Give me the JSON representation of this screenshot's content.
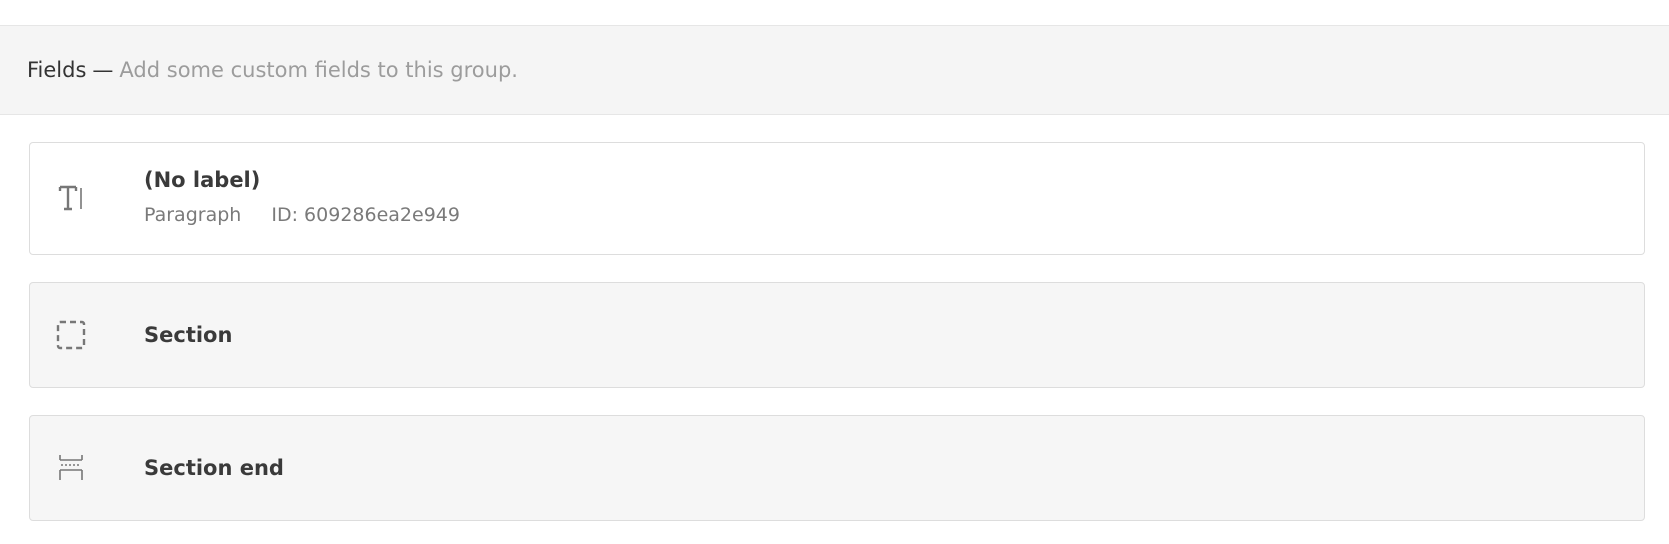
{
  "header": {
    "title": "Fields",
    "separator": "—",
    "description": "Add some custom fields to this group."
  },
  "fields": [
    {
      "label": "(No label)",
      "type": "Paragraph",
      "id_text": "ID: 609286ea2e949",
      "icon": "text-cursor-icon"
    },
    {
      "label": "Section",
      "icon": "dashed-square-icon"
    },
    {
      "label": "Section end",
      "icon": "section-end-icon"
    }
  ],
  "colors": {
    "header_bg": "#f5f5f5",
    "card_border": "#dddddd",
    "grey_card_bg": "#f6f6f6",
    "muted_text": "#9c9c9c"
  }
}
